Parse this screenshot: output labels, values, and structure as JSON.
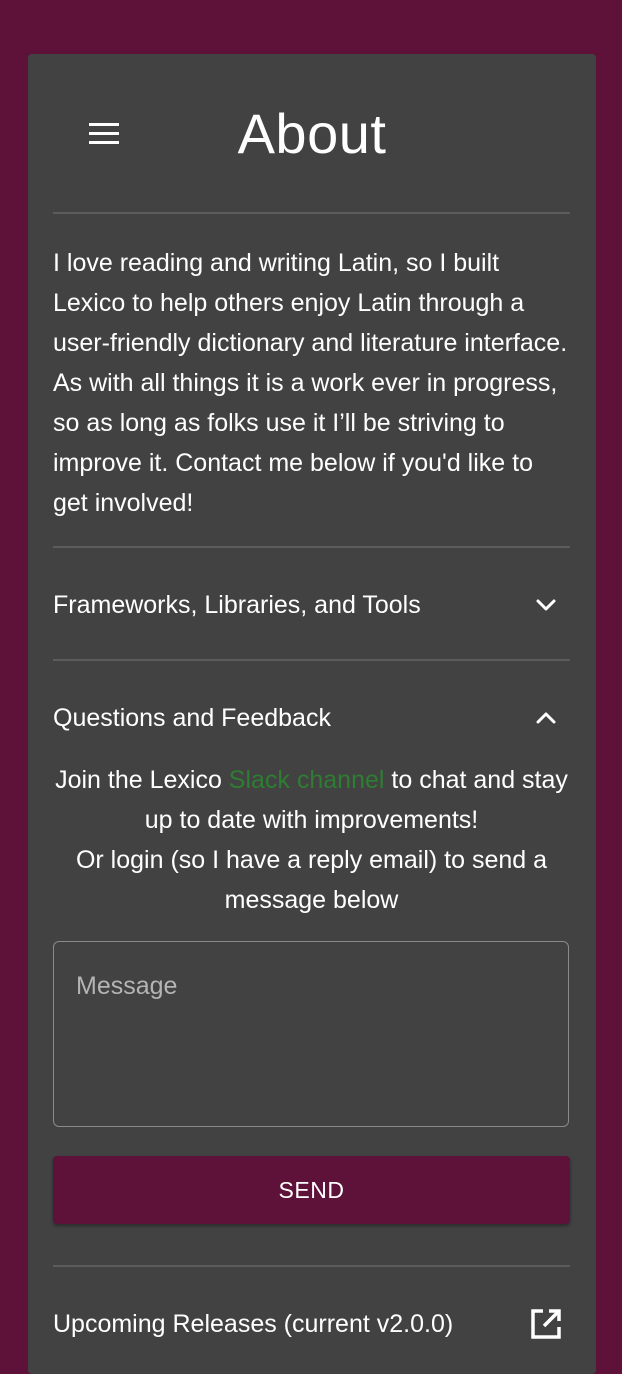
{
  "header": {
    "title": "About",
    "menu_icon": "menu-icon"
  },
  "intro": "I love reading and writing Latin, so I built Lexico to help others enjoy Latin through a user-friendly dictionary and literature interface. As with all things it is a work ever in progress, so as long as folks use it I’ll be striving to improve it. Contact me below if you'd like to get involved!",
  "sections": {
    "frameworks": {
      "label": "Frameworks, Libraries, and Tools",
      "state": "collapsed",
      "icon": "chevron-down-icon"
    },
    "feedback": {
      "label": "Questions and Feedback",
      "state": "expanded",
      "icon": "chevron-up-icon",
      "text_before_link": "Join the Lexico ",
      "link_text": "Slack channel",
      "text_after_link": " to chat and stay up to date with improvements!",
      "login_text": "Or login (so I have a reply email) to send a message below",
      "message_placeholder": "Message",
      "send_label": "SEND"
    },
    "releases": {
      "label": "Upcoming Releases (current v2.0.0)",
      "icon": "open-in-new-icon"
    }
  },
  "colors": {
    "background": "#5e1139",
    "card": "#424242",
    "link": "#2e7d32",
    "button": "#5e1139",
    "divider": "#5c5c5c"
  }
}
